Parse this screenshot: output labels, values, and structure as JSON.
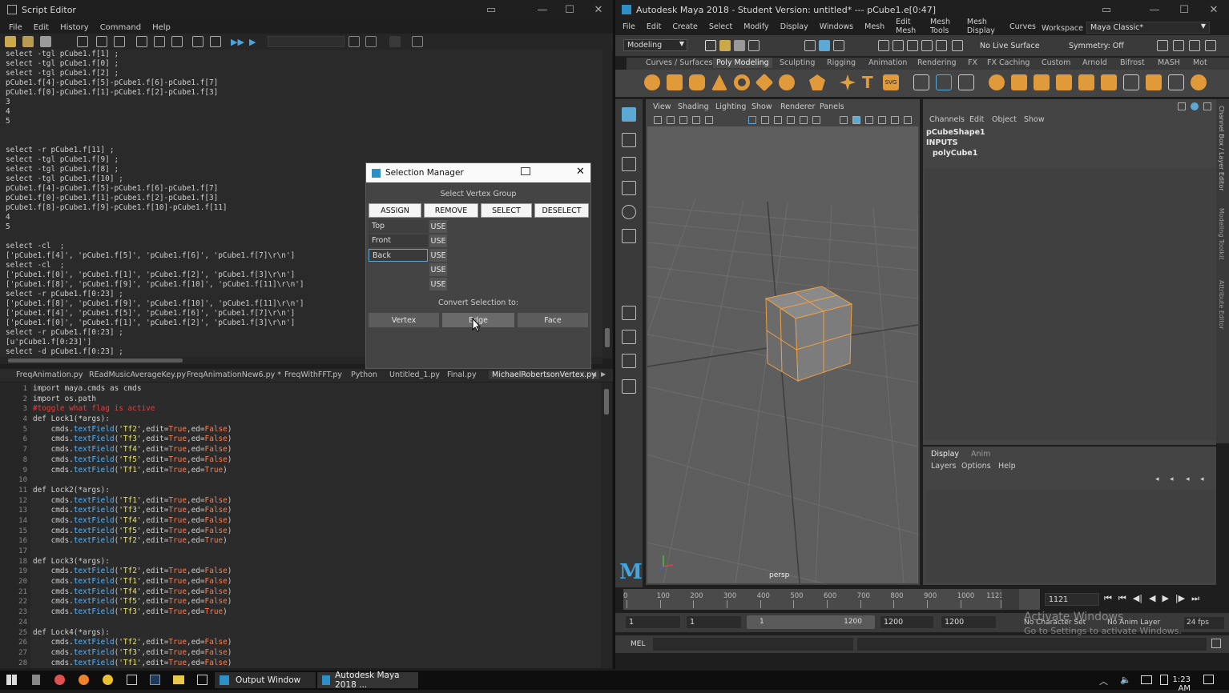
{
  "script_editor": {
    "title": "Script Editor",
    "menus": [
      "File",
      "Edit",
      "History",
      "Command",
      "Help"
    ],
    "output_lines": [
      "select -tgl pCube1.f[1] ;",
      "select -tgl pCube1.f[0] ;",
      "select -tgl pCube1.f[2] ;",
      "pCube1.f[4]-pCube1.f[5]-pCube1.f[6]-pCube1.f[7]",
      "pCube1.f[0]-pCube1.f[1]-pCube1.f[2]-pCube1.f[3]",
      "3",
      "4",
      "5",
      "",
      "",
      "select -r pCube1.f[11] ;",
      "select -tgl pCube1.f[9] ;",
      "select -tgl pCube1.f[8] ;",
      "select -tgl pCube1.f[10] ;",
      "pCube1.f[4]-pCube1.f[5]-pCube1.f[6]-pCube1.f[7]",
      "pCube1.f[0]-pCube1.f[1]-pCube1.f[2]-pCube1.f[3]",
      "pCube1.f[8]-pCube1.f[9]-pCube1.f[10]-pCube1.f[11]",
      "4",
      "5",
      "",
      "select -cl  ;",
      "['pCube1.f[4]', 'pCube1.f[5]', 'pCube1.f[6]', 'pCube1.f[7]\\r\\n']",
      "select -cl  ;",
      "['pCube1.f[0]', 'pCube1.f[1]', 'pCube1.f[2]', 'pCube1.f[3]\\r\\n']",
      "['pCube1.f[8]', 'pCube1.f[9]', 'pCube1.f[10]', 'pCube1.f[11]\\r\\n']",
      "select -r pCube1.f[0:23] ;",
      "['pCube1.f[8]', 'pCube1.f[9]', 'pCube1.f[10]', 'pCube1.f[11]\\r\\n']",
      "['pCube1.f[4]', 'pCube1.f[5]', 'pCube1.f[6]', 'pCube1.f[7]\\r\\n']",
      "['pCube1.f[0]', 'pCube1.f[1]', 'pCube1.f[2]', 'pCube1.f[3]\\r\\n']",
      "select -r pCube1.f[0:23] ;",
      "[u'pCube1.f[0:23]']",
      "select -d pCube1.f[0:23] ;"
    ],
    "tabs": [
      "FreqAnimation.py",
      "REadMusicAverageKey.py",
      "FreqAnimationNew6.py *",
      "FreqWithFFT.py",
      "Python",
      "Untitled_1.py",
      "Final.py",
      "MichaelRobertsonVertex.py"
    ],
    "code_lines": [
      {
        "n": "1",
        "t": "import maya.cmds as cmds",
        "c": "kw"
      },
      {
        "n": "2",
        "t": "import os.path",
        "c": "kw"
      },
      {
        "n": "3",
        "t": "#toggle what flag is active",
        "c": "cm"
      },
      {
        "n": "4",
        "t": "def Lock1(*args):",
        "c": "kw"
      },
      {
        "n": "5",
        "t": "    cmds.textField('Tf2',edit=True,ed=False)",
        "c": "tf"
      },
      {
        "n": "6",
        "t": "    cmds.textField('Tf3',edit=True,ed=False)",
        "c": "tf"
      },
      {
        "n": "7",
        "t": "    cmds.textField('Tf4',edit=True,ed=False)",
        "c": "tf"
      },
      {
        "n": "8",
        "t": "    cmds.textField('Tf5',edit=True,ed=False)",
        "c": "tf"
      },
      {
        "n": "9",
        "t": "    cmds.textField('Tf1',edit=True,ed=True)",
        "c": "tf"
      },
      {
        "n": "10",
        "t": "",
        "c": "kw"
      },
      {
        "n": "11",
        "t": "def Lock2(*args):",
        "c": "kw"
      },
      {
        "n": "12",
        "t": "    cmds.textField('Tf1',edit=True,ed=False)",
        "c": "tf"
      },
      {
        "n": "13",
        "t": "    cmds.textField('Tf3',edit=True,ed=False)",
        "c": "tf"
      },
      {
        "n": "14",
        "t": "    cmds.textField('Tf4',edit=True,ed=False)",
        "c": "tf"
      },
      {
        "n": "15",
        "t": "    cmds.textField('Tf5',edit=True,ed=False)",
        "c": "tf"
      },
      {
        "n": "16",
        "t": "    cmds.textField('Tf2',edit=True,ed=True)",
        "c": "tf"
      },
      {
        "n": "17",
        "t": "",
        "c": "kw"
      },
      {
        "n": "18",
        "t": "def Lock3(*args):",
        "c": "kw"
      },
      {
        "n": "19",
        "t": "    cmds.textField('Tf2',edit=True,ed=False)",
        "c": "tf"
      },
      {
        "n": "20",
        "t": "    cmds.textField('Tf1',edit=True,ed=False)",
        "c": "tf"
      },
      {
        "n": "21",
        "t": "    cmds.textField('Tf4',edit=True,ed=False)",
        "c": "tf"
      },
      {
        "n": "22",
        "t": "    cmds.textField('Tf5',edit=True,ed=False)",
        "c": "tf"
      },
      {
        "n": "23",
        "t": "    cmds.textField('Tf3',edit=True,ed=True)",
        "c": "tf"
      },
      {
        "n": "24",
        "t": "",
        "c": "kw"
      },
      {
        "n": "25",
        "t": "def Lock4(*args):",
        "c": "kw"
      },
      {
        "n": "26",
        "t": "    cmds.textField('Tf2',edit=True,ed=False)",
        "c": "tf"
      },
      {
        "n": "27",
        "t": "    cmds.textField('Tf3',edit=True,ed=False)",
        "c": "tf"
      },
      {
        "n": "28",
        "t": "    cmds.textField('Tf1',edit=True,ed=False)",
        "c": "tf"
      }
    ]
  },
  "selection_manager": {
    "title": "Selection Manager",
    "heading": "Select Vertex Group",
    "buttons": [
      "ASSIGN",
      "REMOVE",
      "SELECT",
      "DESELECT"
    ],
    "rows": [
      {
        "name": "Top",
        "use": "USE"
      },
      {
        "name": "Front",
        "use": "USE"
      },
      {
        "name": "Back",
        "use": "USE"
      },
      {
        "name": "",
        "use": "USE"
      },
      {
        "name": "",
        "use": "USE"
      }
    ],
    "convert_label": "Convert Selection to:",
    "convert_buttons": [
      "Vertex",
      "Edge",
      "Face"
    ]
  },
  "maya": {
    "title": "Autodesk Maya 2018 - Student Version: untitled*   ---   pCube1.e[0:47]",
    "menus": [
      "File",
      "Edit",
      "Create",
      "Select",
      "Modify",
      "Display",
      "Windows",
      "Mesh",
      "Edit Mesh",
      "Mesh Tools",
      "Mesh Display",
      "Curves"
    ],
    "workspace_label": "Workspace :",
    "workspace_value": "Maya Classic*",
    "mode": "Modeling",
    "live_surface": "No Live Surface",
    "symmetry": "Symmetry: Off",
    "shelf_tabs": [
      "Curves / Surfaces",
      "Poly Modeling",
      "Sculpting",
      "Rigging",
      "Animation",
      "Rendering",
      "FX",
      "FX Caching",
      "Custom",
      "Arnold",
      "Bifrost",
      "MASH",
      "Mot"
    ],
    "active_shelf": "Poly Modeling",
    "viewport_menus": [
      "View",
      "Shading",
      "Lighting",
      "Show",
      "Renderer",
      "Panels"
    ],
    "camera_label": "persp",
    "channel_menus": [
      "Channels",
      "Edit",
      "Object",
      "Show"
    ],
    "channel_items": [
      "pCubeShape1",
      "INPUTS",
      "polyCube1"
    ],
    "layer_tabs": [
      "Display",
      "Anim"
    ],
    "layer_menus": [
      "Layers",
      "Options",
      "Help"
    ],
    "side_tabs": [
      "Channel Box / Layer Editor",
      "Modeling Toolkit",
      "Attribute Editor"
    ],
    "timeline_ticks": [
      "0",
      "100",
      "200",
      "300",
      "400",
      "500",
      "600",
      "700",
      "800",
      "900",
      "1000",
      "1121"
    ],
    "current_frame": "1121",
    "range": {
      "start": "1",
      "start2": "1",
      "slider_start": "1",
      "slider_end": "1200",
      "end": "1200",
      "end2": "1200"
    },
    "no_char_set": "No Character Set",
    "no_anim_layer": "No Anim Layer",
    "fps": "24 fps",
    "mel_label": "MEL",
    "activate_title": "Activate Windows",
    "activate_sub": "Go to Settings to activate Windows."
  },
  "taskbar": {
    "items": [
      "Output Window",
      "Autodesk Maya 2018 ..."
    ],
    "time": "1:23 AM"
  },
  "colors": {
    "accent": "#5ca9d6",
    "selected_edge": "#f0a040",
    "comment": "#e04040",
    "function": "#53b5ff",
    "string": "#e6e37a",
    "true": "#ff7b4e"
  }
}
